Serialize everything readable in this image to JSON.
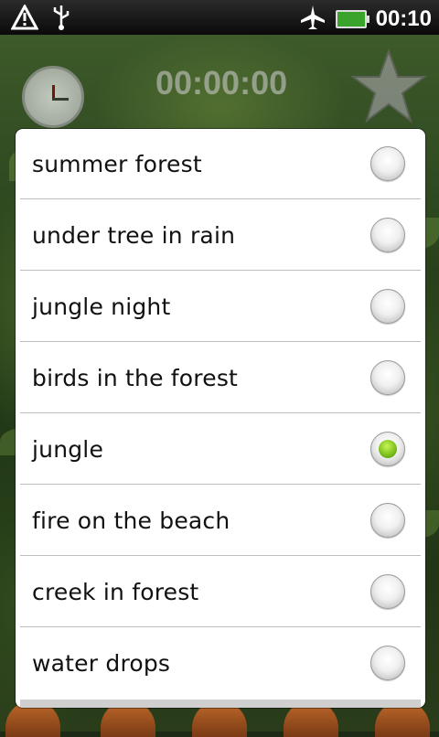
{
  "status_bar": {
    "time": "00:10",
    "icons": [
      "warning-icon",
      "usb-icon",
      "airplane-mode-icon",
      "battery-charging-icon"
    ]
  },
  "app": {
    "timer": "00:00:00",
    "alarm_icon": "alarm-clock-icon",
    "favorite_icon": "star-icon"
  },
  "dialog": {
    "options": [
      {
        "label": "summer forest",
        "selected": false
      },
      {
        "label": "under tree in rain",
        "selected": false
      },
      {
        "label": "jungle night",
        "selected": false
      },
      {
        "label": "birds in the forest",
        "selected": false
      },
      {
        "label": "jungle",
        "selected": true
      },
      {
        "label": "fire on the beach",
        "selected": false
      },
      {
        "label": "creek in forest",
        "selected": false
      },
      {
        "label": "water drops",
        "selected": false
      }
    ]
  },
  "colors": {
    "radio_selected": "#7ec31b",
    "divider": "#bdbdbd"
  }
}
